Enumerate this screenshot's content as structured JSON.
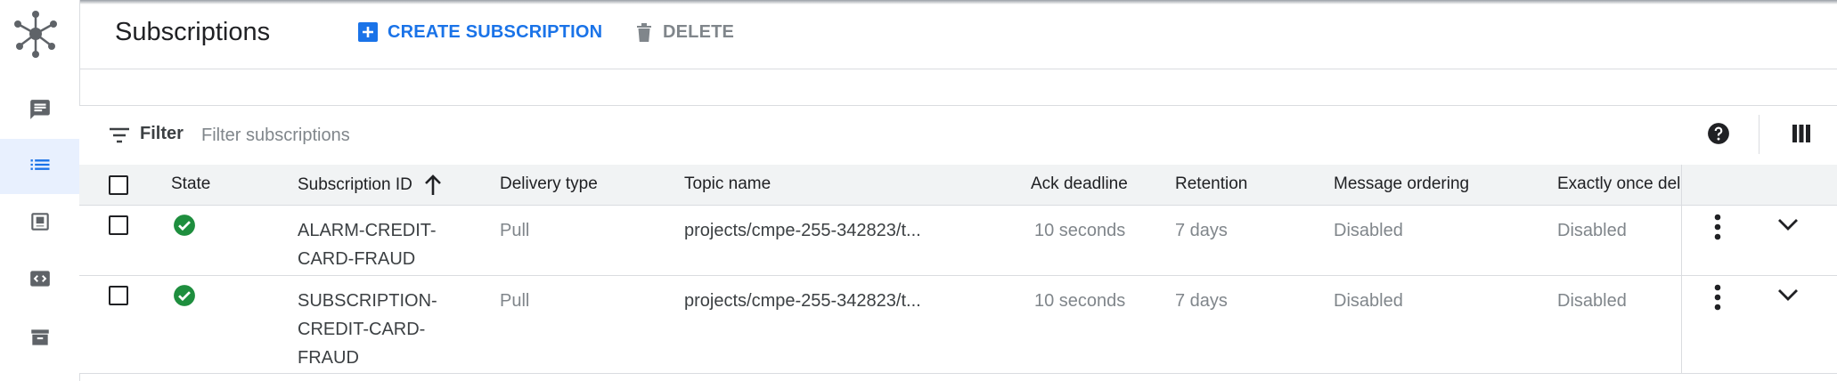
{
  "header": {
    "title": "Subscriptions",
    "create_label": "CREATE SUBSCRIPTION",
    "delete_label": "DELETE"
  },
  "filter": {
    "label": "Filter",
    "placeholder": "Filter subscriptions"
  },
  "table": {
    "columns": [
      "State",
      "Subscription ID",
      "Delivery type",
      "Topic name",
      "Ack deadline",
      "Retention",
      "Message ordering",
      "Exactly once del"
    ],
    "sort_column": "Subscription ID",
    "sort_direction": "ascending",
    "rows": [
      {
        "state": "active",
        "id_lines": [
          "ALARM-CREDIT-",
          "CARD-FRAUD"
        ],
        "delivery": "Pull",
        "topic": "projects/cmpe-255-342823/t...",
        "ack": "10 seconds",
        "retention": "7 days",
        "ordering": "Disabled",
        "exactly_once": "Disabled"
      },
      {
        "state": "active",
        "id_lines": [
          "SUBSCRIPTION-",
          "CREDIT-CARD-",
          "FRAUD"
        ],
        "delivery": "Pull",
        "topic": "projects/cmpe-255-342823/t...",
        "ack": "10 seconds",
        "retention": "7 days",
        "ordering": "Disabled",
        "exactly_once": "Disabled"
      }
    ]
  },
  "icons": {
    "rail": [
      "pubsub-logo-icon",
      "chat-bubble-icon",
      "list-icon",
      "snapshot-icon",
      "code-icon",
      "archive-icon"
    ],
    "header": [
      "add-box-icon",
      "trash-icon"
    ],
    "filterbar": [
      "filter-lines-icon",
      "help-icon",
      "column-display-icon"
    ],
    "row_actions": [
      "more-vert-icon",
      "chevron-down-icon"
    ]
  },
  "colors": {
    "accent": "#1a73e8",
    "status_ok": "#1e8e3e",
    "rail_active_bg": "#e8f0fe",
    "header_row_bg": "#f1f3f4"
  }
}
